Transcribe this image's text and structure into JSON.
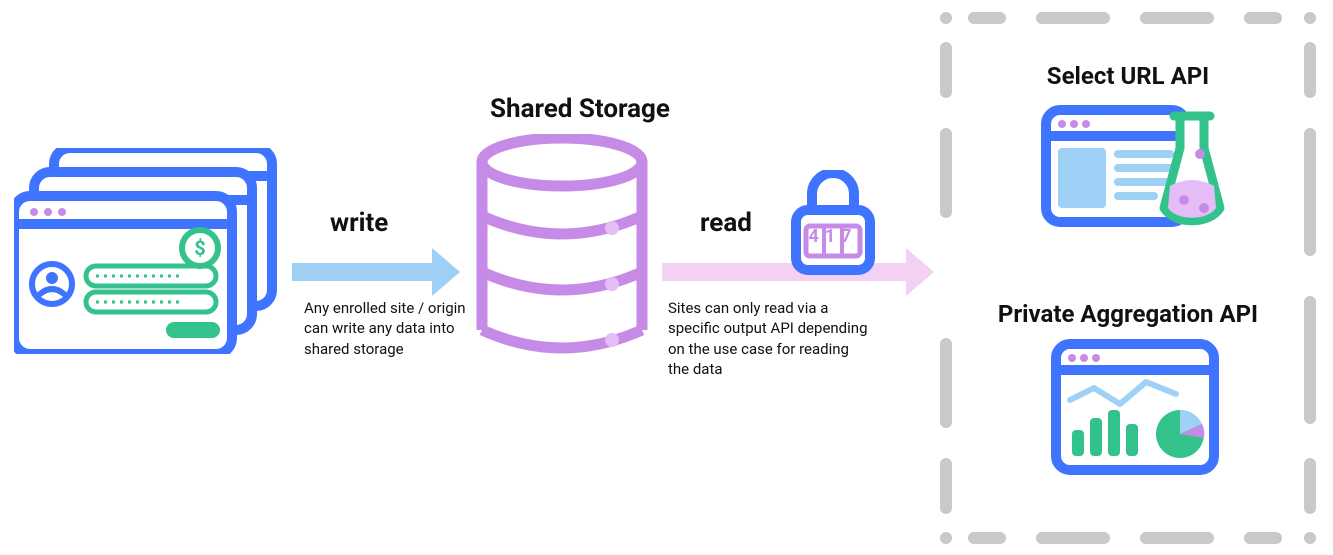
{
  "colors": {
    "blue": "#3E74FF",
    "green": "#34C28C",
    "purple": "#C68BE6",
    "purple_light": "#E4BDF6",
    "arrow_blue": "#9FD0F6",
    "arrow_pink": "#F3D1F4",
    "gray": "#C9C9C9",
    "text": "#111111"
  },
  "diagram": {
    "storage_title": "Shared Storage",
    "write_label": "write",
    "write_caption": "Any enrolled site / origin can write any data into shared storage",
    "read_label": "read",
    "read_caption": "Sites can only read via a specific output API depending on the use case for reading the data",
    "lock_value": "417",
    "outputs": {
      "select_url_title": "Select URL API",
      "private_aggregation_title": "Private Aggregation API"
    }
  }
}
